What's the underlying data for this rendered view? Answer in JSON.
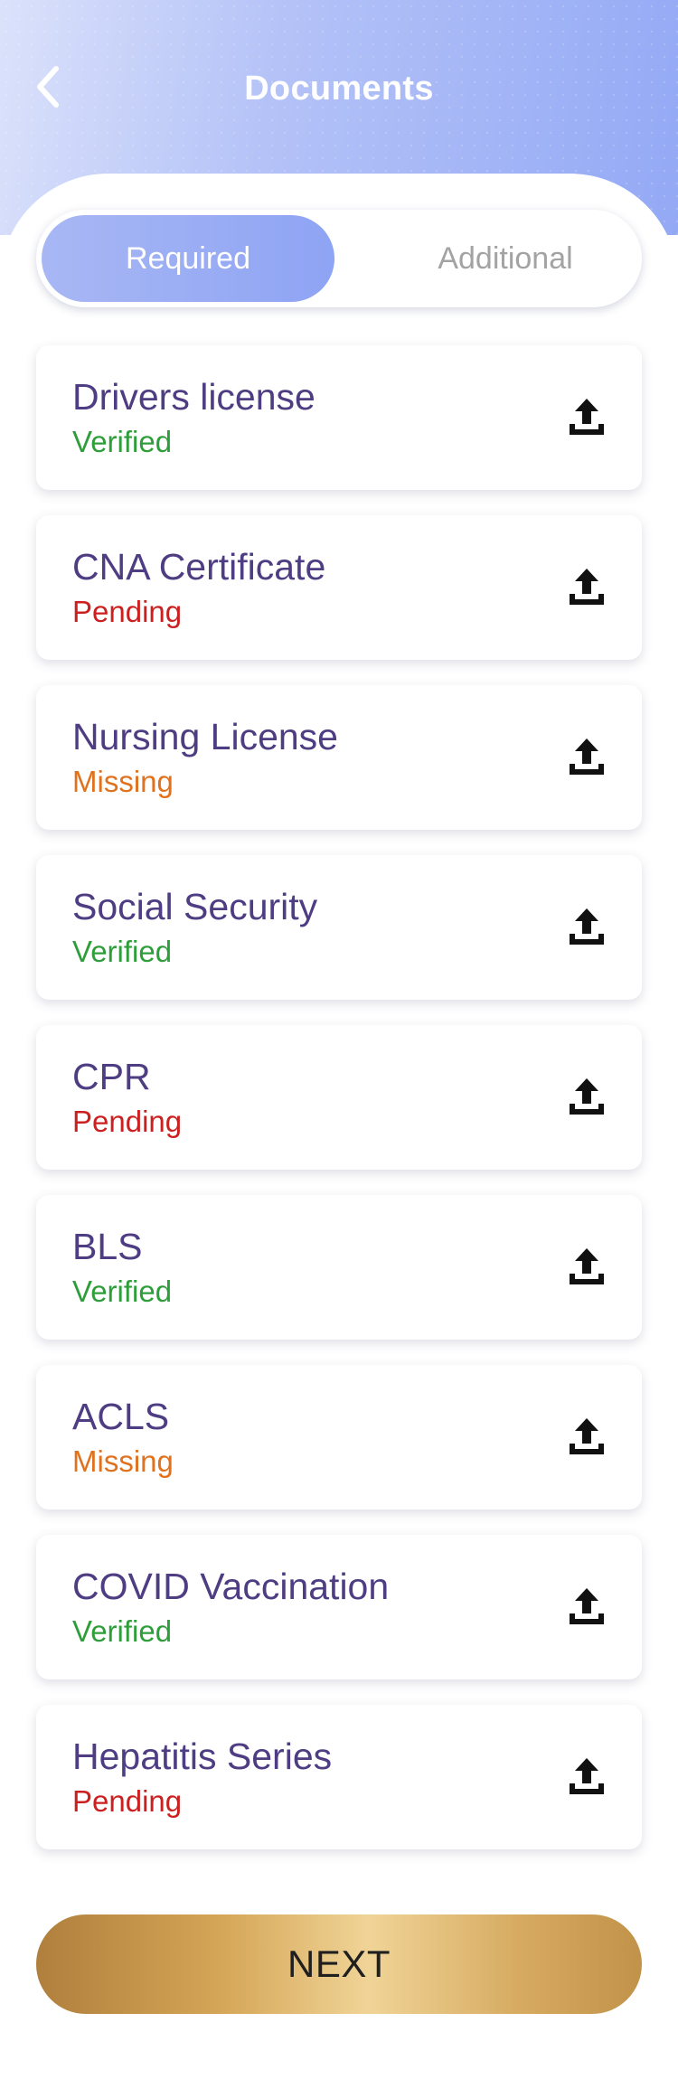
{
  "header": {
    "title": "Documents",
    "back_icon": "chevron-left-icon"
  },
  "tabs": [
    {
      "label": "Required",
      "active": true
    },
    {
      "label": "Additional",
      "active": false
    }
  ],
  "colors": {
    "verified": "#2e9e3a",
    "pending": "#cc2020",
    "missing": "#e0721f",
    "doc_name": "#4e3d82"
  },
  "documents": [
    {
      "name": "Drivers license",
      "status": "Verified",
      "status_key": "verified"
    },
    {
      "name": "CNA Certificate",
      "status": "Pending",
      "status_key": "pending"
    },
    {
      "name": "Nursing License",
      "status": "Missing",
      "status_key": "missing"
    },
    {
      "name": "Social Security",
      "status": "Verified",
      "status_key": "verified"
    },
    {
      "name": "CPR",
      "status": "Pending",
      "status_key": "pending"
    },
    {
      "name": "BLS",
      "status": "Verified",
      "status_key": "verified"
    },
    {
      "name": "ACLS",
      "status": "Missing",
      "status_key": "missing"
    },
    {
      "name": "COVID Vaccination",
      "status": "Verified",
      "status_key": "verified"
    },
    {
      "name": "Hepatitis Series",
      "status": "Pending",
      "status_key": "pending"
    }
  ],
  "upload_icon": "upload-icon",
  "footer": {
    "next_label": "NEXT"
  }
}
